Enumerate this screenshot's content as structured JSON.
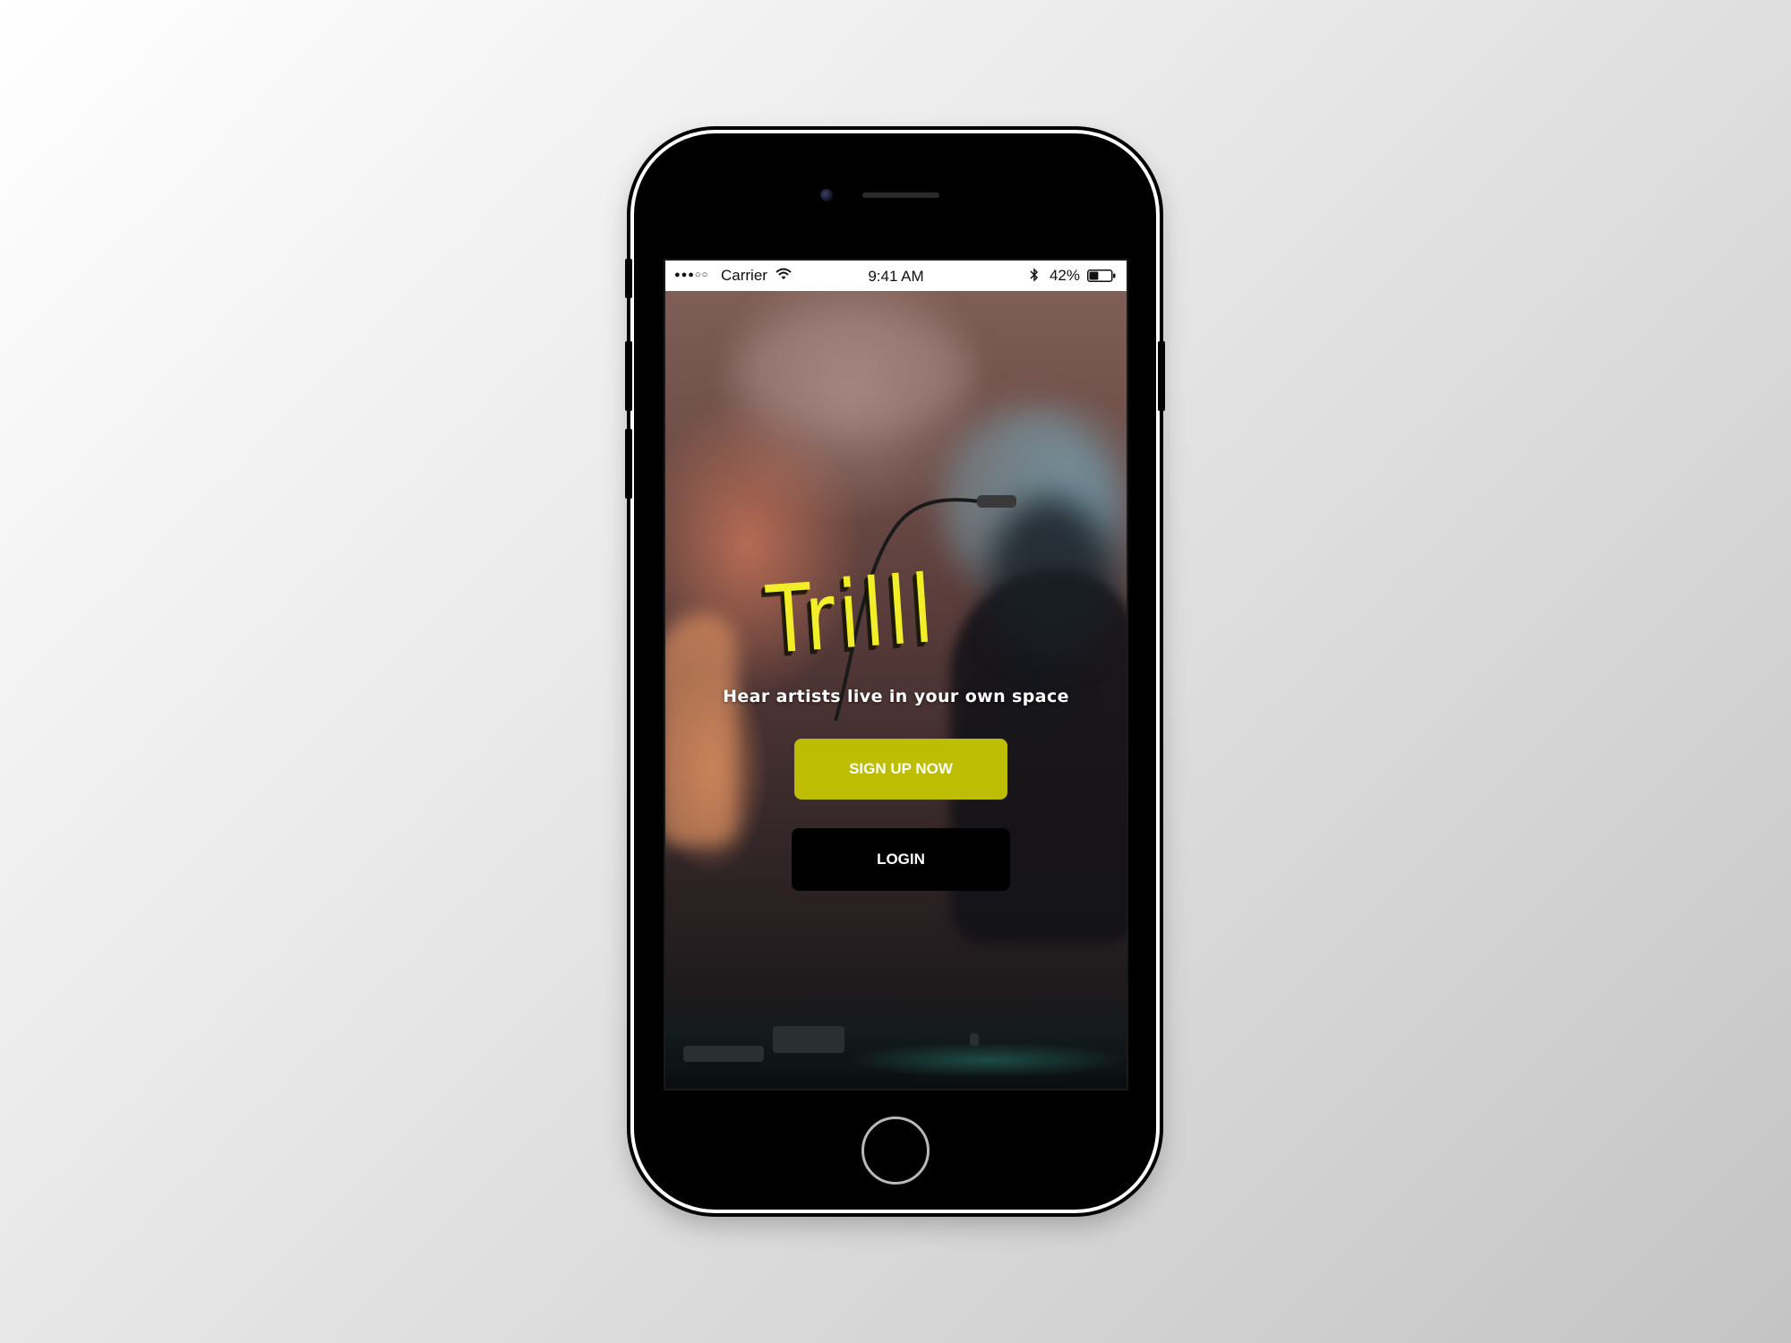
{
  "status_bar": {
    "signal": "●●●○○",
    "carrier": "Carrier",
    "time": "9:41 AM",
    "battery_percent": "42%",
    "battery_level": 0.42
  },
  "app": {
    "logo_text": "Trilll",
    "tagline": "Hear artists live in your own space",
    "signup_label": "SIGN UP NOW",
    "login_label": "LOGIN"
  },
  "colors": {
    "logo_yellow": "#f2ee2a",
    "signup_button": "#bdbd04",
    "login_button": "#000000",
    "phone_frame": "#000000"
  },
  "icons": [
    "wifi-icon",
    "bluetooth-icon",
    "battery-icon",
    "signal-dots-icon",
    "home-button"
  ]
}
